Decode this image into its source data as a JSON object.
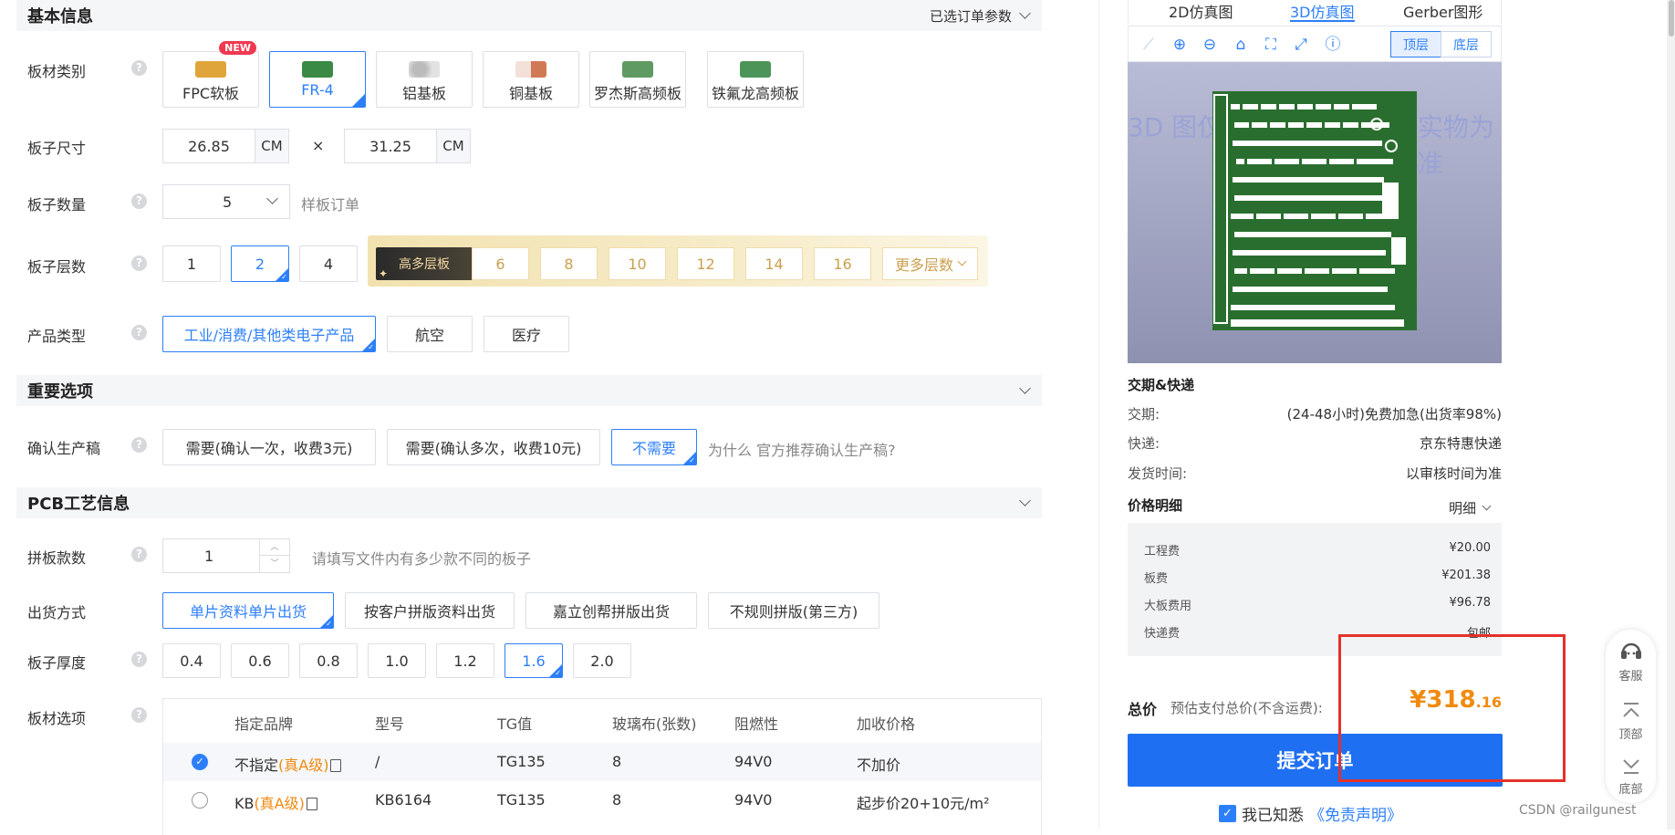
{
  "sections": {
    "basic": {
      "title": "基本信息",
      "right_label": "已选订单参数"
    },
    "important": {
      "title": "重要选项"
    },
    "pcb": {
      "title": "PCB工艺信息"
    }
  },
  "labels": {
    "material": "板材类别",
    "size": "板子尺寸",
    "quantity": "板子数量",
    "layers": "板子层数",
    "product_type": "产品类型",
    "confirm": "确认生产稿",
    "panel_count": "拼板款数",
    "ship_mode": "出货方式",
    "thickness": "板子厚度",
    "board_options": "板材选项"
  },
  "help_glyph": "?",
  "materials": [
    {
      "label": "FPC软板",
      "badge": "NEW",
      "thumb_color": "#e0a53a"
    },
    {
      "label": "FR-4",
      "selected": true,
      "thumb_color": "#3a8a45"
    },
    {
      "label": "铝基板",
      "thumb_color": "#c8c8c8"
    },
    {
      "label": "铜基板",
      "thumb_color": "#d07a55"
    },
    {
      "label": "罗杰斯高频板",
      "thumb_color": "#5f9a62"
    },
    {
      "label": "铁氟龙高频板",
      "thumb_color": "#4c9458"
    }
  ],
  "size": {
    "width": "26.85",
    "height": "31.25",
    "unit": "CM",
    "times": "×"
  },
  "quantity": {
    "value": "5",
    "hint": "样板订单"
  },
  "layers": {
    "basic": [
      {
        "label": "1"
      },
      {
        "label": "2",
        "selected": true
      },
      {
        "label": "4"
      }
    ],
    "premium_tag": "高多层板",
    "premium": [
      "6",
      "8",
      "10",
      "12",
      "14",
      "16"
    ],
    "more": "更多层数"
  },
  "product_types": [
    {
      "label": "工业/消费/其他类电子产品",
      "selected": true
    },
    {
      "label": "航空"
    },
    {
      "label": "医疗"
    }
  ],
  "confirm_options": [
    {
      "label": "需要(确认一次，收费3元)"
    },
    {
      "label": "需要(确认多次，收费10元)"
    },
    {
      "label": "不需要",
      "selected": true
    }
  ],
  "confirm_hint": "为什么 官方推荐确认生产稿?",
  "panel": {
    "value": "1",
    "hint": "请填写文件内有多少款不同的板子"
  },
  "ship_modes": [
    {
      "label": "单片资料单片出货",
      "selected": true
    },
    {
      "label": "按客户拼版资料出货"
    },
    {
      "label": "嘉立创帮拼版出货"
    },
    {
      "label": "不规则拼版(第三方)"
    }
  ],
  "thickness": [
    {
      "label": "0.4"
    },
    {
      "label": "0.6"
    },
    {
      "label": "0.8"
    },
    {
      "label": "1.0"
    },
    {
      "label": "1.2"
    },
    {
      "label": "1.6",
      "selected": true
    },
    {
      "label": "2.0"
    }
  ],
  "board_table": {
    "headers": [
      "指定品牌",
      "型号",
      "TG值",
      "玻璃布(张数)",
      "阻燃性",
      "加收价格"
    ],
    "rows": [
      {
        "brand": "不指定",
        "grade": "(真A级)",
        "model": "/",
        "tg": "TG135",
        "glass": "8",
        "flame": "94V0",
        "price": "不加价",
        "selected": true
      },
      {
        "brand": "KB",
        "grade": "(真A级)",
        "model": "KB6164",
        "tg": "TG135",
        "glass": "8",
        "flame": "94V0",
        "price": "起步价20+10元/m²"
      }
    ]
  },
  "right": {
    "tabs": [
      {
        "label": "2D仿真图"
      },
      {
        "label": "3D仿真图",
        "active": true
      },
      {
        "label": "Gerber图形"
      }
    ],
    "layer_top": "顶层",
    "layer_bottom": "底层",
    "watermark_left": "3D 图仅",
    "watermark_right": "实物为准",
    "delivery_title": "交期&快递",
    "delivery": [
      {
        "k": "交期:",
        "v": "(24-48小时)免费加急(出货率98%)"
      },
      {
        "k": "快递:",
        "v": "京东特惠快递"
      },
      {
        "k": "发货时间:",
        "v": "以审核时间为准"
      }
    ],
    "price_title": "价格明细",
    "detail_label": "明细",
    "prices": [
      {
        "k": "工程费",
        "v": "¥20.00"
      },
      {
        "k": "板费",
        "v": "¥201.38"
      },
      {
        "k": "大板费用",
        "v": "¥96.78"
      },
      {
        "k": "快递费",
        "v": "包邮"
      }
    ],
    "total_label": "总价",
    "total_hint": "预估支付总价(不含运费):",
    "total_main": "¥318",
    "total_cents": ".16",
    "submit": "提交订单",
    "agree_prefix": "我已知悉",
    "agree_link": "《免责声明》"
  },
  "float": [
    {
      "label": "客服",
      "icon": "headset-icon"
    },
    {
      "label": "顶部",
      "icon": "arrow-up-icon"
    },
    {
      "label": "底部",
      "icon": "arrow-down-icon"
    }
  ],
  "footer_credit": "CSDN @railgunest"
}
